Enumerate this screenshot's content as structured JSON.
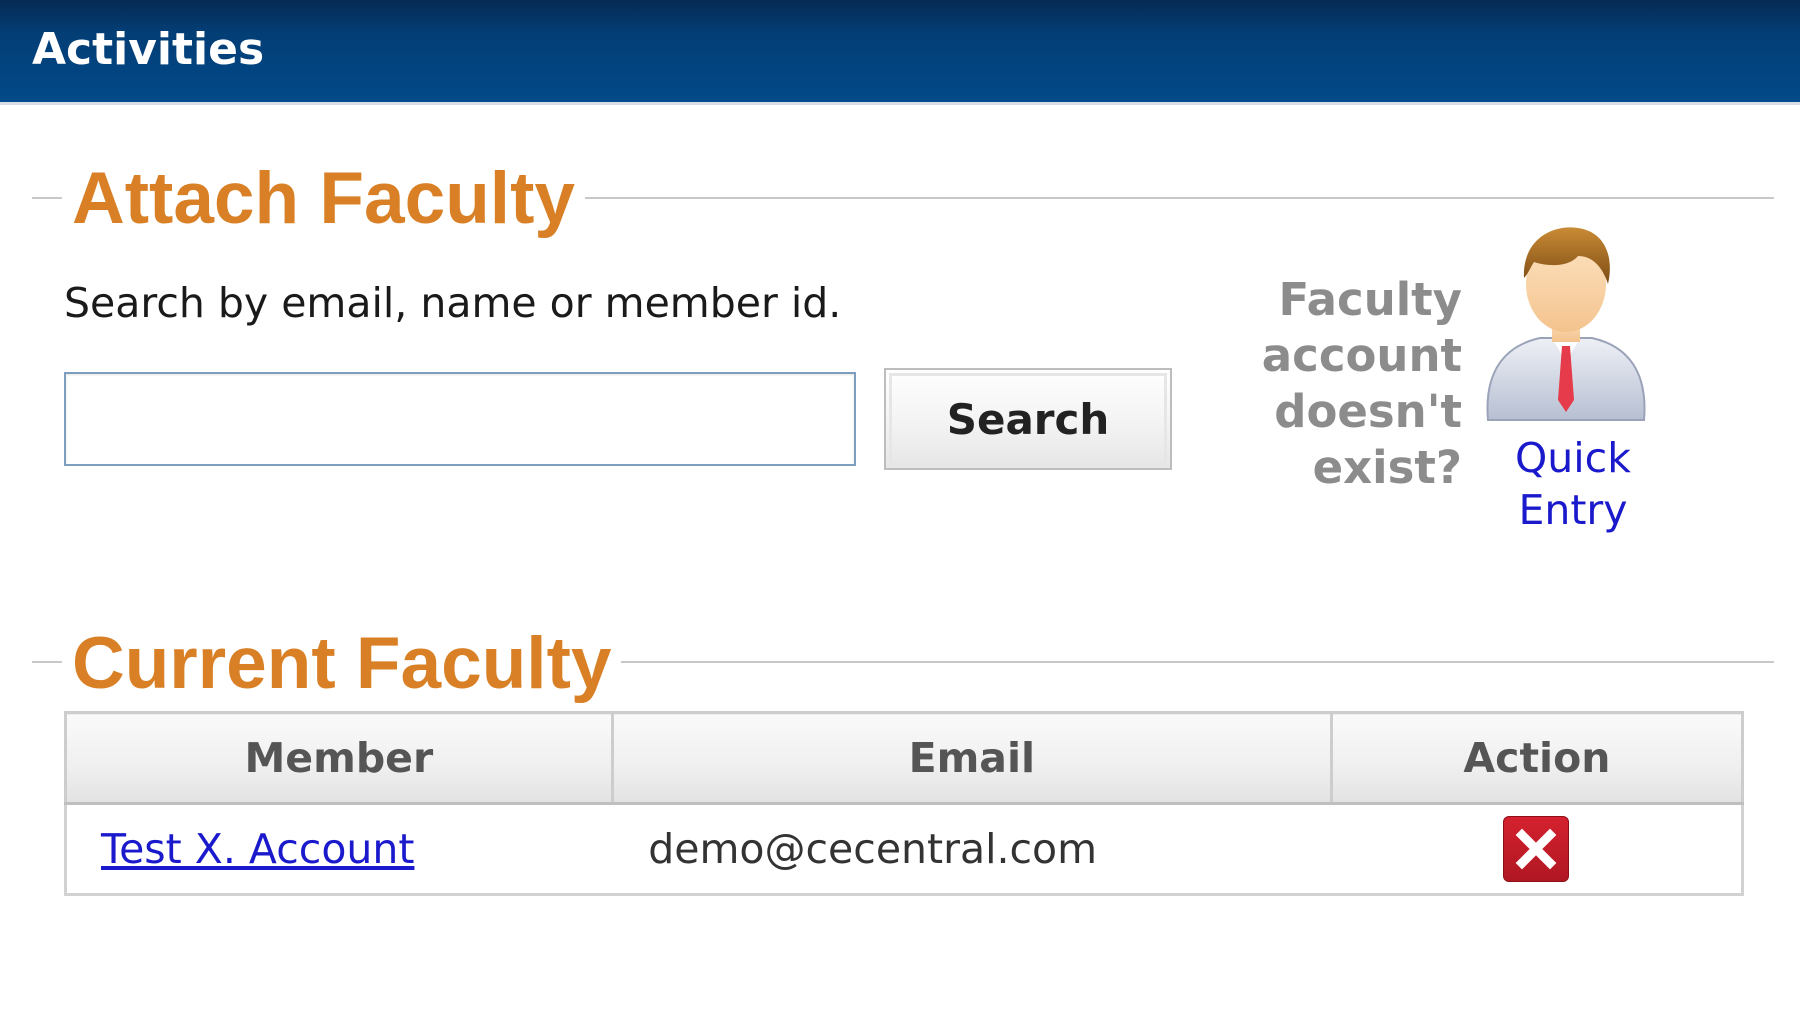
{
  "header": {
    "title": "Activities"
  },
  "attach": {
    "heading": "Attach Faculty",
    "instruction": "Search by email, name or member id.",
    "search_value": "",
    "search_button": "Search",
    "quick_entry": {
      "question_lines": [
        "Faculty",
        "account",
        "doesn't",
        "exist?"
      ],
      "link_lines": [
        "Quick",
        "Entry"
      ]
    }
  },
  "current": {
    "heading": "Current Faculty",
    "columns": [
      "Member",
      "Email",
      "Action"
    ],
    "rows": [
      {
        "member": "Test X. Account",
        "email": "demo@cecentral.com"
      }
    ]
  },
  "icons": {
    "person": "person-avatar-icon",
    "delete": "close-x-icon"
  },
  "colors": {
    "header_bg": "#033d74",
    "section_heading": "#d98026",
    "link": "#1a1acc",
    "delete_button": "#c01c28",
    "muted_text": "#8c8c8c"
  }
}
